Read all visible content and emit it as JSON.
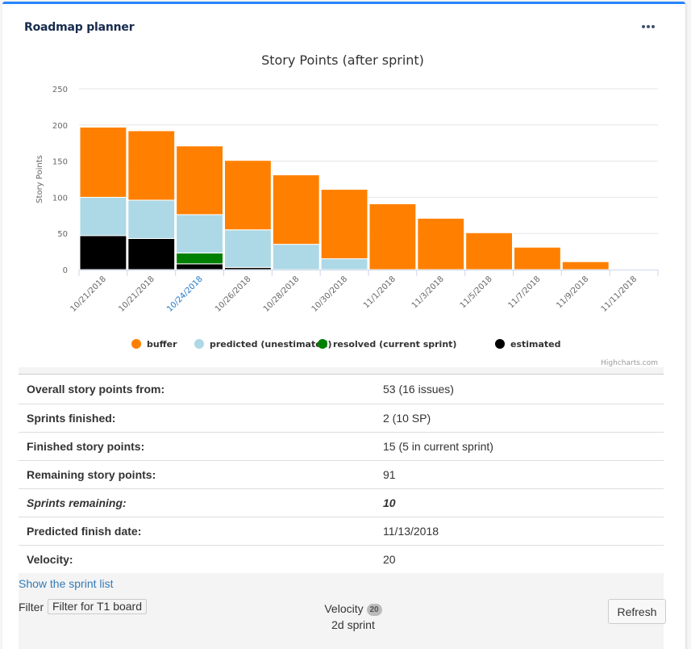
{
  "widget": {
    "title": "Roadmap planner",
    "menu_icon": "more-horizontal-icon"
  },
  "chart_data": {
    "type": "bar",
    "stacked": true,
    "title": "Story Points (after sprint)",
    "xlabel": "",
    "ylabel": "Story Points",
    "ylim": [
      0,
      250
    ],
    "yticks": [
      0,
      50,
      100,
      150,
      200,
      250
    ],
    "grid": true,
    "legend_position": "bottom",
    "categories": [
      "10/21/2018",
      "10/21/2018",
      "10/24/2018",
      "10/26/2018",
      "10/28/2018",
      "10/30/2018",
      "11/1/2018",
      "11/3/2018",
      "11/5/2018",
      "11/7/2018",
      "11/9/2018",
      "11/11/2018"
    ],
    "highlighted_category_index": 2,
    "series": [
      {
        "name": "buffer",
        "color": "#ff8000",
        "values": [
          97,
          96,
          95,
          96,
          96,
          96,
          91,
          71,
          51,
          31,
          11,
          0
        ]
      },
      {
        "name": "predicted (unestimated)",
        "color": "#add8e6",
        "values": [
          53,
          53,
          53,
          52,
          35,
          15,
          0,
          0,
          0,
          0,
          0,
          0
        ]
      },
      {
        "name": "resolved (current sprint)",
        "color": "#008000",
        "values": [
          0,
          0,
          15,
          0,
          0,
          0,
          0,
          0,
          0,
          0,
          0,
          0
        ]
      },
      {
        "name": "estimated",
        "color": "#000000",
        "values": [
          47,
          43,
          8,
          3,
          0,
          0,
          0,
          0,
          0,
          0,
          0,
          0
        ]
      }
    ],
    "credits": "Highcharts.com"
  },
  "stats": [
    {
      "label": "Overall story points from:",
      "value": "53 (16 issues)",
      "italic": false
    },
    {
      "label": "Sprints finished:",
      "value": "2 (10 SP)",
      "italic": false
    },
    {
      "label": "Finished story points:",
      "value": "15 (5 in current sprint)",
      "italic": false
    },
    {
      "label": "Remaining story points:",
      "value": "91",
      "italic": false
    },
    {
      "label": "Sprints remaining:",
      "value": "10",
      "italic": true
    },
    {
      "label": "Predicted finish date:",
      "value": "11/13/2018",
      "italic": false
    },
    {
      "label": "Velocity:",
      "value": "20",
      "italic": false
    }
  ],
  "footer": {
    "sprint_list_link": "Show the sprint list",
    "filter_label": "Filter",
    "filter_button": "Filter for T1 board",
    "velocity_label": "Velocity",
    "velocity_badge": "20",
    "sprint_length": "2d sprint",
    "refresh_button": "Refresh"
  }
}
